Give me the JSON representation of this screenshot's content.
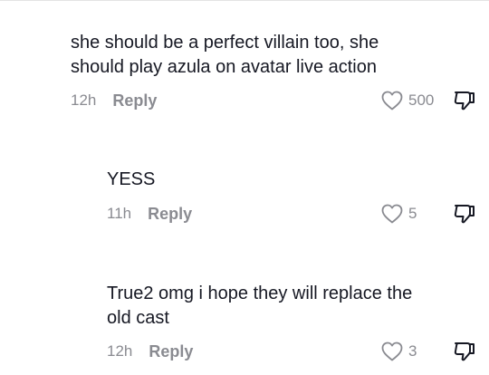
{
  "comments": [
    {
      "lines": [
        "she should be a perfect villain too, she",
        "should play azula on avatar live action"
      ],
      "time": "12h",
      "reply_label": "Reply",
      "likes": "500"
    },
    {
      "lines": [
        "YESS"
      ],
      "time": "11h",
      "reply_label": "Reply",
      "likes": "5"
    },
    {
      "lines": [
        "True2 omg i hope they will replace the",
        "old cast"
      ],
      "time": "12h",
      "reply_label": "Reply",
      "likes": "3"
    }
  ],
  "icons": {
    "like": "heart-outline-icon",
    "dislike": "thumb-down-icon"
  },
  "colors": {
    "text": "#161823",
    "muted": "#8a8b91"
  }
}
